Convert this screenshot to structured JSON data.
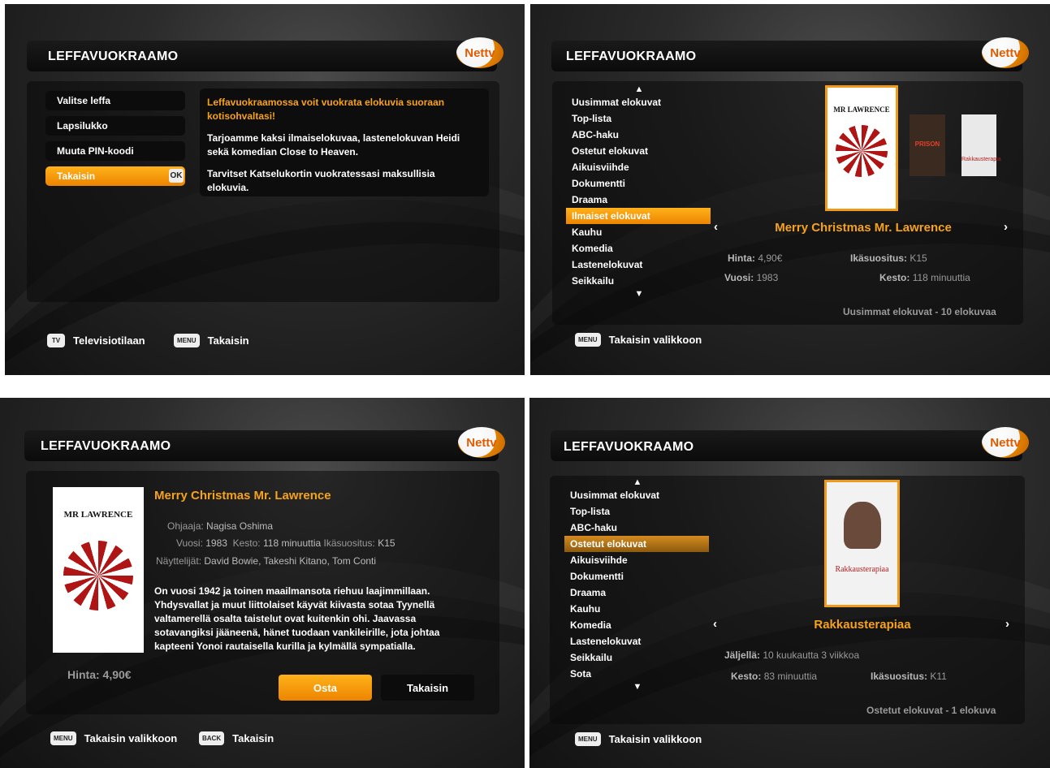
{
  "app_title": "LEFFAVUOKRAAMO",
  "logo_text": "Nettv",
  "colors": {
    "accent": "#f7a21b",
    "selected_bg": "#ec8400",
    "background": "#1e1e1e"
  },
  "screen1": {
    "menu": [
      {
        "label": "Valitse leffa"
      },
      {
        "label": "Lapsilukko"
      },
      {
        "label": "Muuta PIN-koodi"
      },
      {
        "label": "Takaisin",
        "badge": "OK"
      }
    ],
    "info_headline": "Leffavuokraamossa voit vuokrata elokuvia suoraan kotisohvaltasi!",
    "info_p1": "Tarjoamme kaksi ilmaiselokuvaa, lastenelokuvan Heidi sekä komedian Close to Heaven.",
    "info_p2": "Tarvitset Katselukortin vuokratessasi maksullisia elokuvia.",
    "footer_tv_key": "TV",
    "footer_tv_label": "Televisiotilaan",
    "footer_menu_key": "MENU",
    "footer_menu_label": "Takaisin"
  },
  "screen2": {
    "categories": [
      "Uusimmat elokuvat",
      "Top-lista",
      "ABC-haku",
      "Ostetut elokuvat",
      "Aikuisviihde",
      "Dokumentti",
      "Draama",
      "Ilmaiset elokuvat",
      "Kauhu",
      "Komedia",
      "Lastenelokuvat",
      "Seikkailu"
    ],
    "selected_category": "Ilmaiset elokuvat",
    "movie_title": "Merry Christmas Mr. Lawrence",
    "poster_top": "MR LAWRENCE",
    "thumb1_text": "PRISON",
    "thumb2_text": "Rakkausterapia",
    "price_label": "Hinta:",
    "price_value": "4,90€",
    "age_label": "Ikäsuositus:",
    "age_value": "K15",
    "year_label": "Vuosi:",
    "year_value": "1983",
    "duration_label": "Kesto:",
    "duration_value": "118 minuuttia",
    "count_text": "Uusimmat elokuvat - 10 elokuvaa",
    "footer_menu_key": "MENU",
    "footer_label": "Takaisin valikkoon"
  },
  "screen3": {
    "movie_title": "Merry Christmas Mr. Lawrence",
    "poster_top": "MR LAWRENCE",
    "director_label": "Ohjaaja:",
    "director_value": "Nagisa Oshima",
    "year_label": "Vuosi:",
    "year_value": "1983",
    "duration_label": "Kesto:",
    "duration_value": "118 minuuttia",
    "age_label": "Ikäsuositus:",
    "age_value": "K15",
    "actors_label": "Näyttelijät:",
    "actors_value": "David Bowie, Takeshi Kitano, Tom Conti",
    "synopsis": "On vuosi 1942 ja toinen maailmansota riehuu laajimmillaan. Yhdysvallat ja muut liittolaiset käyvät kiivasta sotaa Tyynellä valtamerellä osalta taistelut ovat kuitenkin ohi. Jaavassa sotavangiksi jääneenä, hänet tuodaan vankileirille, jota johtaa kapteeni Yonoi rautaisella kurilla ja kylmällä sympatialla.",
    "price_text": "Hinta: 4,90€",
    "buy_button": "Osta",
    "back_button": "Takaisin",
    "footer_menu_key": "MENU",
    "footer_menu_label": "Takaisin valikkoon",
    "footer_back_key": "BACK",
    "footer_back_label": "Takaisin"
  },
  "screen4": {
    "categories": [
      "Uusimmat elokuvat",
      "Top-lista",
      "ABC-haku",
      "Ostetut elokuvat",
      "Aikuisviihde",
      "Dokumentti",
      "Draama",
      "Kauhu",
      "Komedia",
      "Lastenelokuvat",
      "Seikkailu",
      "Sota"
    ],
    "selected_category": "Ostetut elokuvat",
    "movie_title": "Rakkausterapiaa",
    "poster_text": "Rakkausterapiaa",
    "remaining_label": "Jäljellä:",
    "remaining_value": "10 kuukautta 3 viikkoa",
    "duration_label": "Kesto:",
    "duration_value": "83 minuuttia",
    "age_label": "Ikäsuositus:",
    "age_value": "K11",
    "count_text": "Ostetut elokuvat - 1 elokuva",
    "footer_menu_key": "MENU",
    "footer_label": "Takaisin valikkoon"
  }
}
